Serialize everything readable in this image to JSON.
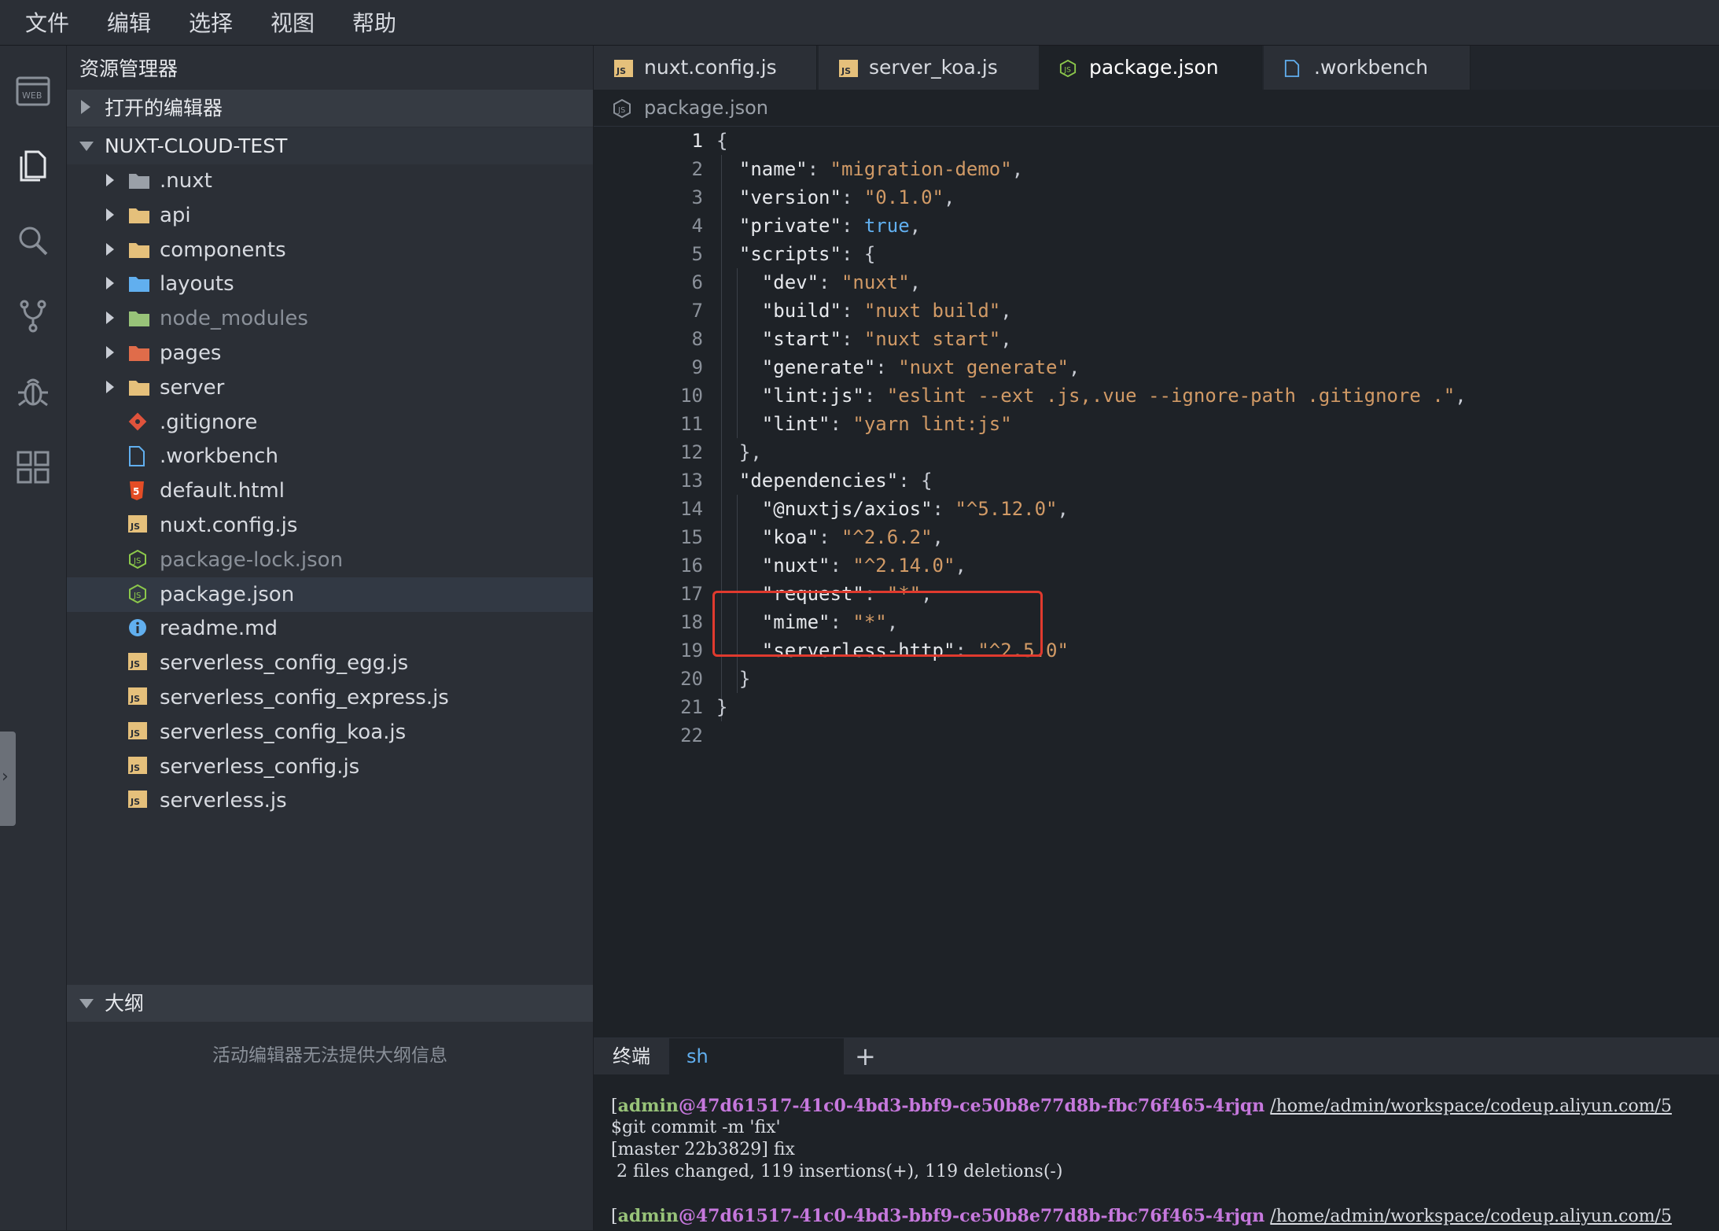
{
  "menubar": {
    "items": [
      "文件",
      "编辑",
      "选择",
      "视图",
      "帮助"
    ]
  },
  "activitybar": {
    "icons": [
      "web-logo-icon",
      "files-icon",
      "search-icon",
      "source-control-icon",
      "debug-icon",
      "extensions-icon"
    ]
  },
  "sidebar": {
    "title": "资源管理器",
    "open_editors": "打开的编辑器",
    "project": "NUXT-CLOUD-TEST",
    "tree": [
      {
        "name": ".nuxt",
        "type": "folder",
        "color": "#9aa0a8"
      },
      {
        "name": "api",
        "type": "folder",
        "color": "#e5c07b"
      },
      {
        "name": "components",
        "type": "folder",
        "color": "#e5c07b"
      },
      {
        "name": "layouts",
        "type": "folder",
        "color": "#61afef"
      },
      {
        "name": "node_modules",
        "type": "folder",
        "color": "#98c379"
      },
      {
        "name": "pages",
        "type": "folder",
        "color": "#e06c4a"
      },
      {
        "name": "server",
        "type": "folder",
        "color": "#e5c07b"
      },
      {
        "name": ".gitignore",
        "type": "git"
      },
      {
        "name": ".workbench",
        "type": "file"
      },
      {
        "name": "default.html",
        "type": "html"
      },
      {
        "name": "nuxt.config.js",
        "type": "js"
      },
      {
        "name": "package-lock.json",
        "type": "node"
      },
      {
        "name": "package.json",
        "type": "node"
      },
      {
        "name": "readme.md",
        "type": "info"
      },
      {
        "name": "serverless_config_egg.js",
        "type": "js"
      },
      {
        "name": "serverless_config_express.js",
        "type": "js"
      },
      {
        "name": "serverless_config_koa.js",
        "type": "js"
      },
      {
        "name": "serverless_config.js",
        "type": "js"
      },
      {
        "name": "serverless.js",
        "type": "js"
      }
    ],
    "outline_title": "大纲",
    "outline_empty": "活动编辑器无法提供大纲信息"
  },
  "tabs": [
    {
      "label": "nuxt.config.js",
      "icon": "js-icon"
    },
    {
      "label": "server_koa.js",
      "icon": "js-icon"
    },
    {
      "label": "package.json",
      "icon": "node-icon",
      "active": true
    },
    {
      "label": ".workbench",
      "icon": "file-icon"
    }
  ],
  "breadcrumb": "package.json",
  "editor": {
    "line_numbers": [
      "1",
      "2",
      "3",
      "4",
      "5",
      "6",
      "7",
      "8",
      "9",
      "10",
      "11",
      "12",
      "13",
      "14",
      "15",
      "16",
      "17",
      "18",
      "19",
      "20",
      "21",
      "22"
    ],
    "lines": [
      [
        {
          "t": "{",
          "c": "p"
        }
      ],
      [
        {
          "t": "  \"name\"",
          "c": "k"
        },
        {
          "t": ": ",
          "c": "p"
        },
        {
          "t": "\"migration-demo\"",
          "c": "s"
        },
        {
          "t": ",",
          "c": "p"
        }
      ],
      [
        {
          "t": "  \"version\"",
          "c": "k"
        },
        {
          "t": ": ",
          "c": "p"
        },
        {
          "t": "\"0.1.0\"",
          "c": "s"
        },
        {
          "t": ",",
          "c": "p"
        }
      ],
      [
        {
          "t": "  \"private\"",
          "c": "k"
        },
        {
          "t": ": ",
          "c": "p"
        },
        {
          "t": "true",
          "c": "bool"
        },
        {
          "t": ",",
          "c": "p"
        }
      ],
      [
        {
          "t": "  \"scripts\"",
          "c": "k"
        },
        {
          "t": ": {",
          "c": "p"
        }
      ],
      [
        {
          "t": "    \"dev\"",
          "c": "k"
        },
        {
          "t": ": ",
          "c": "p"
        },
        {
          "t": "\"nuxt\"",
          "c": "s"
        },
        {
          "t": ",",
          "c": "p"
        }
      ],
      [
        {
          "t": "    \"build\"",
          "c": "k"
        },
        {
          "t": ": ",
          "c": "p"
        },
        {
          "t": "\"nuxt build\"",
          "c": "s"
        },
        {
          "t": ",",
          "c": "p"
        }
      ],
      [
        {
          "t": "    \"start\"",
          "c": "k"
        },
        {
          "t": ": ",
          "c": "p"
        },
        {
          "t": "\"nuxt start\"",
          "c": "s"
        },
        {
          "t": ",",
          "c": "p"
        }
      ],
      [
        {
          "t": "    \"generate\"",
          "c": "k"
        },
        {
          "t": ": ",
          "c": "p"
        },
        {
          "t": "\"nuxt generate\"",
          "c": "s"
        },
        {
          "t": ",",
          "c": "p"
        }
      ],
      [
        {
          "t": "    \"lint:js\"",
          "c": "k"
        },
        {
          "t": ": ",
          "c": "p"
        },
        {
          "t": "\"eslint --ext .js,.vue --ignore-path .gitignore .\"",
          "c": "s"
        },
        {
          "t": ",",
          "c": "p"
        }
      ],
      [
        {
          "t": "    \"lint\"",
          "c": "k"
        },
        {
          "t": ": ",
          "c": "p"
        },
        {
          "t": "\"yarn lint:js\"",
          "c": "s"
        }
      ],
      [
        {
          "t": "  },",
          "c": "p"
        }
      ],
      [
        {
          "t": "  \"dependencies\"",
          "c": "k"
        },
        {
          "t": ": {",
          "c": "p"
        }
      ],
      [
        {
          "t": "    \"@nuxtjs/axios\"",
          "c": "k"
        },
        {
          "t": ": ",
          "c": "p"
        },
        {
          "t": "\"^5.12.0\"",
          "c": "s"
        },
        {
          "t": ",",
          "c": "p"
        }
      ],
      [
        {
          "t": "    \"koa\"",
          "c": "k"
        },
        {
          "t": ": ",
          "c": "p"
        },
        {
          "t": "\"^2.6.2\"",
          "c": "s"
        },
        {
          "t": ",",
          "c": "p"
        }
      ],
      [
        {
          "t": "    \"nuxt\"",
          "c": "k"
        },
        {
          "t": ": ",
          "c": "p"
        },
        {
          "t": "\"^2.14.0\"",
          "c": "s"
        },
        {
          "t": ",",
          "c": "p"
        }
      ],
      [
        {
          "t": "    \"request\"",
          "c": "k"
        },
        {
          "t": ": ",
          "c": "p"
        },
        {
          "t": "\"*\"",
          "c": "s"
        },
        {
          "t": ",",
          "c": "p"
        }
      ],
      [
        {
          "t": "    \"mime\"",
          "c": "k"
        },
        {
          "t": ": ",
          "c": "p"
        },
        {
          "t": "\"*\"",
          "c": "s"
        },
        {
          "t": ",",
          "c": "p"
        }
      ],
      [
        {
          "t": "    \"serverless-http\"",
          "c": "k"
        },
        {
          "t": ": ",
          "c": "p"
        },
        {
          "t": "\"^2.5.0\"",
          "c": "s"
        }
      ],
      [
        {
          "t": "  }",
          "c": "p"
        }
      ],
      [
        {
          "t": "}",
          "c": "p"
        }
      ],
      [
        {
          "t": "",
          "c": "p"
        }
      ]
    ],
    "highlight_color": "#e03a2e"
  },
  "terminal": {
    "title": "终端",
    "shell_tab": "sh",
    "add_label": "+",
    "prompt_user": "admin",
    "prompt_at": "@",
    "prompt_host": "47d61517-41c0-4bd3-bbf9-ce50b8e77d8b-fbc76f465-4rjqn",
    "prompt_path": "/home/admin/workspace/codeup.aliyun.com/5",
    "output": [
      "$git commit -m 'fix'",
      "[master 22b3829] fix",
      " 2 files changed, 119 insertions(+), 119 deletions(-)"
    ]
  }
}
